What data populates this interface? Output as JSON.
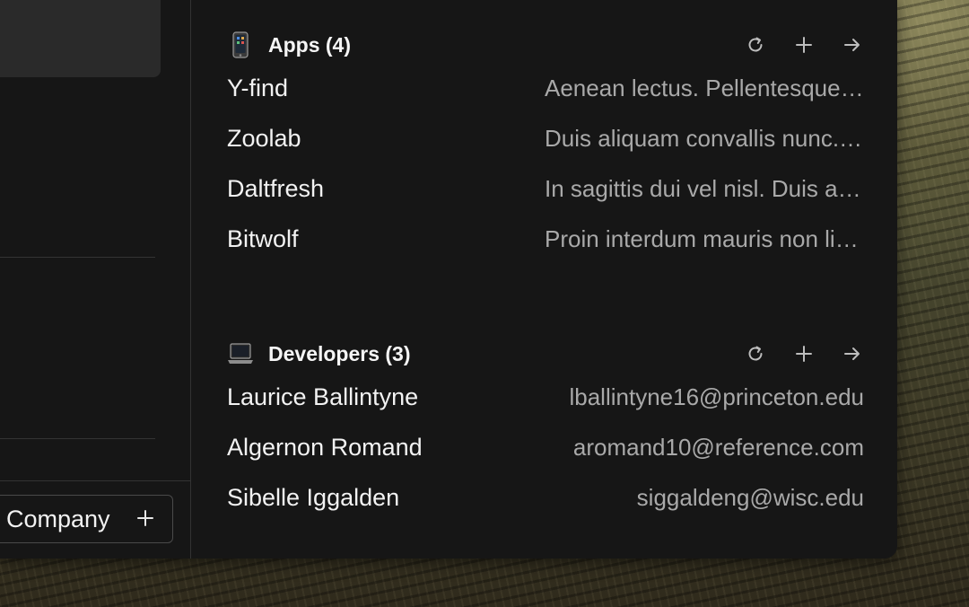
{
  "sidebar": {
    "company_button": {
      "label": "Company",
      "icon": "plus-icon"
    }
  },
  "apps": {
    "title": "Apps (4)",
    "icon": "mobile-phone-icon",
    "actions": [
      "refresh-icon",
      "plus-icon",
      "arrow-right-icon"
    ],
    "items": [
      {
        "name": "Y-find",
        "desc": "Aenean lectus. Pellentesque eget nunc."
      },
      {
        "name": "Zoolab",
        "desc": "Duis aliquam convallis nunc. Proin at turpis."
      },
      {
        "name": "Daltfresh",
        "desc": "In sagittis dui vel nisl. Duis ac nibh."
      },
      {
        "name": "Bitwolf",
        "desc": "Proin interdum mauris non ligula pellentesque."
      }
    ]
  },
  "developers": {
    "title": "Developers (3)",
    "icon": "laptop-icon",
    "actions": [
      "refresh-icon",
      "plus-icon",
      "arrow-right-icon"
    ],
    "items": [
      {
        "name": "Laurice Ballintyne",
        "desc": "lballintyne16@princeton.edu"
      },
      {
        "name": "Algernon Romand",
        "desc": "aromand10@reference.com"
      },
      {
        "name": "Sibelle Iggalden",
        "desc": "siggaldeng@wisc.edu"
      }
    ]
  },
  "colors": {
    "panel_bg": "#161616",
    "text_primary": "#f2f2f2",
    "text_secondary": "#a9a9a9"
  }
}
